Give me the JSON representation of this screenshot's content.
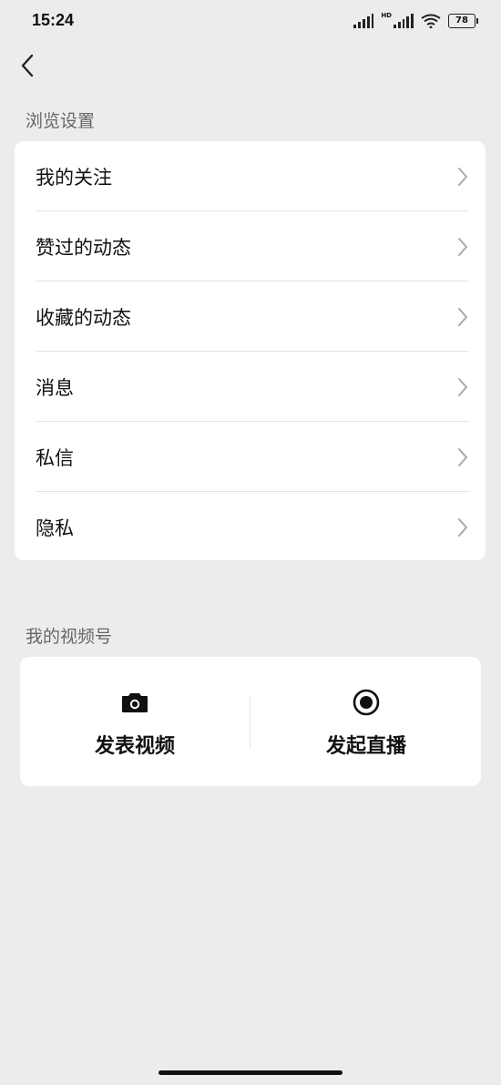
{
  "status_bar": {
    "time": "15:24",
    "battery": "78",
    "hd_label": "HD"
  },
  "browse_settings": {
    "title": "浏览设置",
    "items": [
      {
        "label": "我的关注"
      },
      {
        "label": "赞过的动态"
      },
      {
        "label": "收藏的动态"
      },
      {
        "label": "消息"
      },
      {
        "label": "私信"
      },
      {
        "label": "隐私"
      }
    ]
  },
  "channels": {
    "title": "我的视频号",
    "post_video_label": "发表视频",
    "go_live_label": "发起直播"
  },
  "icons": {
    "back": "chevron-left-icon",
    "item_arrow": "chevron-right-icon",
    "post_video": "camera-icon",
    "go_live": "record-icon"
  }
}
